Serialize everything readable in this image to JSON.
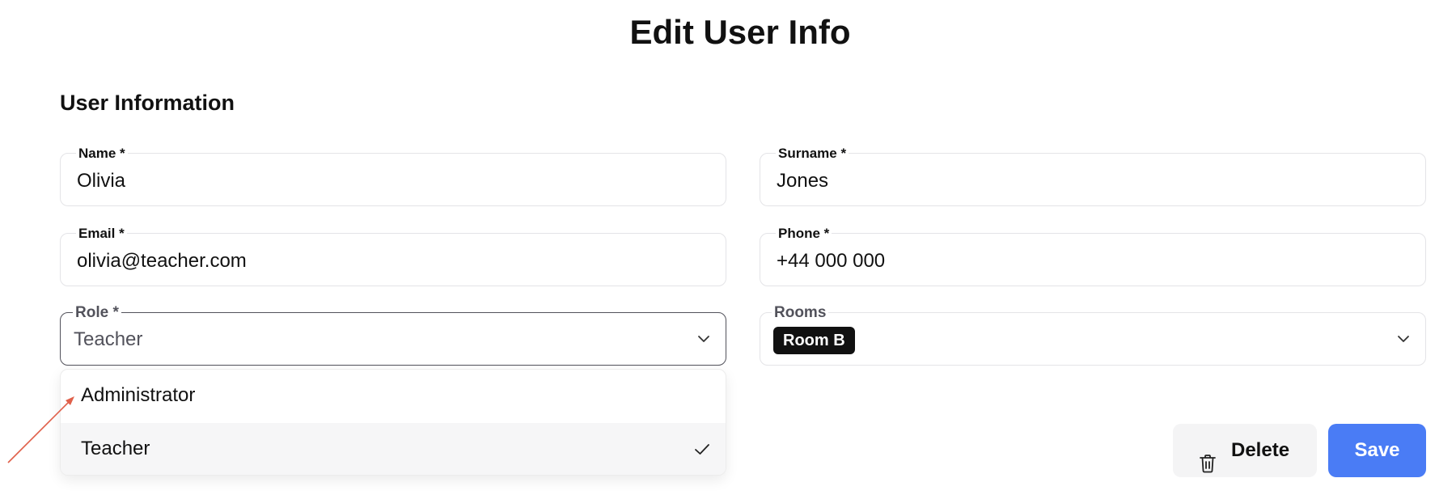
{
  "page": {
    "title": "Edit User Info"
  },
  "section": {
    "title": "User Information"
  },
  "fields": {
    "name": {
      "label": "Name *",
      "value": "Olivia"
    },
    "surname": {
      "label": "Surname *",
      "value": "Jones"
    },
    "email": {
      "label": "Email *",
      "value": "olivia@teacher.com"
    },
    "phone": {
      "label": "Phone *",
      "value": "+44 000 000"
    },
    "role": {
      "label": "Role *",
      "value": "Teacher"
    },
    "rooms": {
      "label": "Rooms",
      "chips": [
        "Room B"
      ]
    }
  },
  "role_dropdown": {
    "options": [
      {
        "label": "Administrator",
        "selected": false
      },
      {
        "label": "Teacher",
        "selected": true
      }
    ]
  },
  "actions": {
    "delete_label": "Delete",
    "save_label": "Save"
  },
  "icons": {
    "dropdown": "chevron-down-icon",
    "selected": "check-icon",
    "delete": "trash-icon",
    "annotation": "red-arrow-icon"
  },
  "colors": {
    "save": "#4a7cf5",
    "chip": "#111111",
    "annotation": "#e0604a",
    "delete_bg": "#f4f4f5"
  }
}
